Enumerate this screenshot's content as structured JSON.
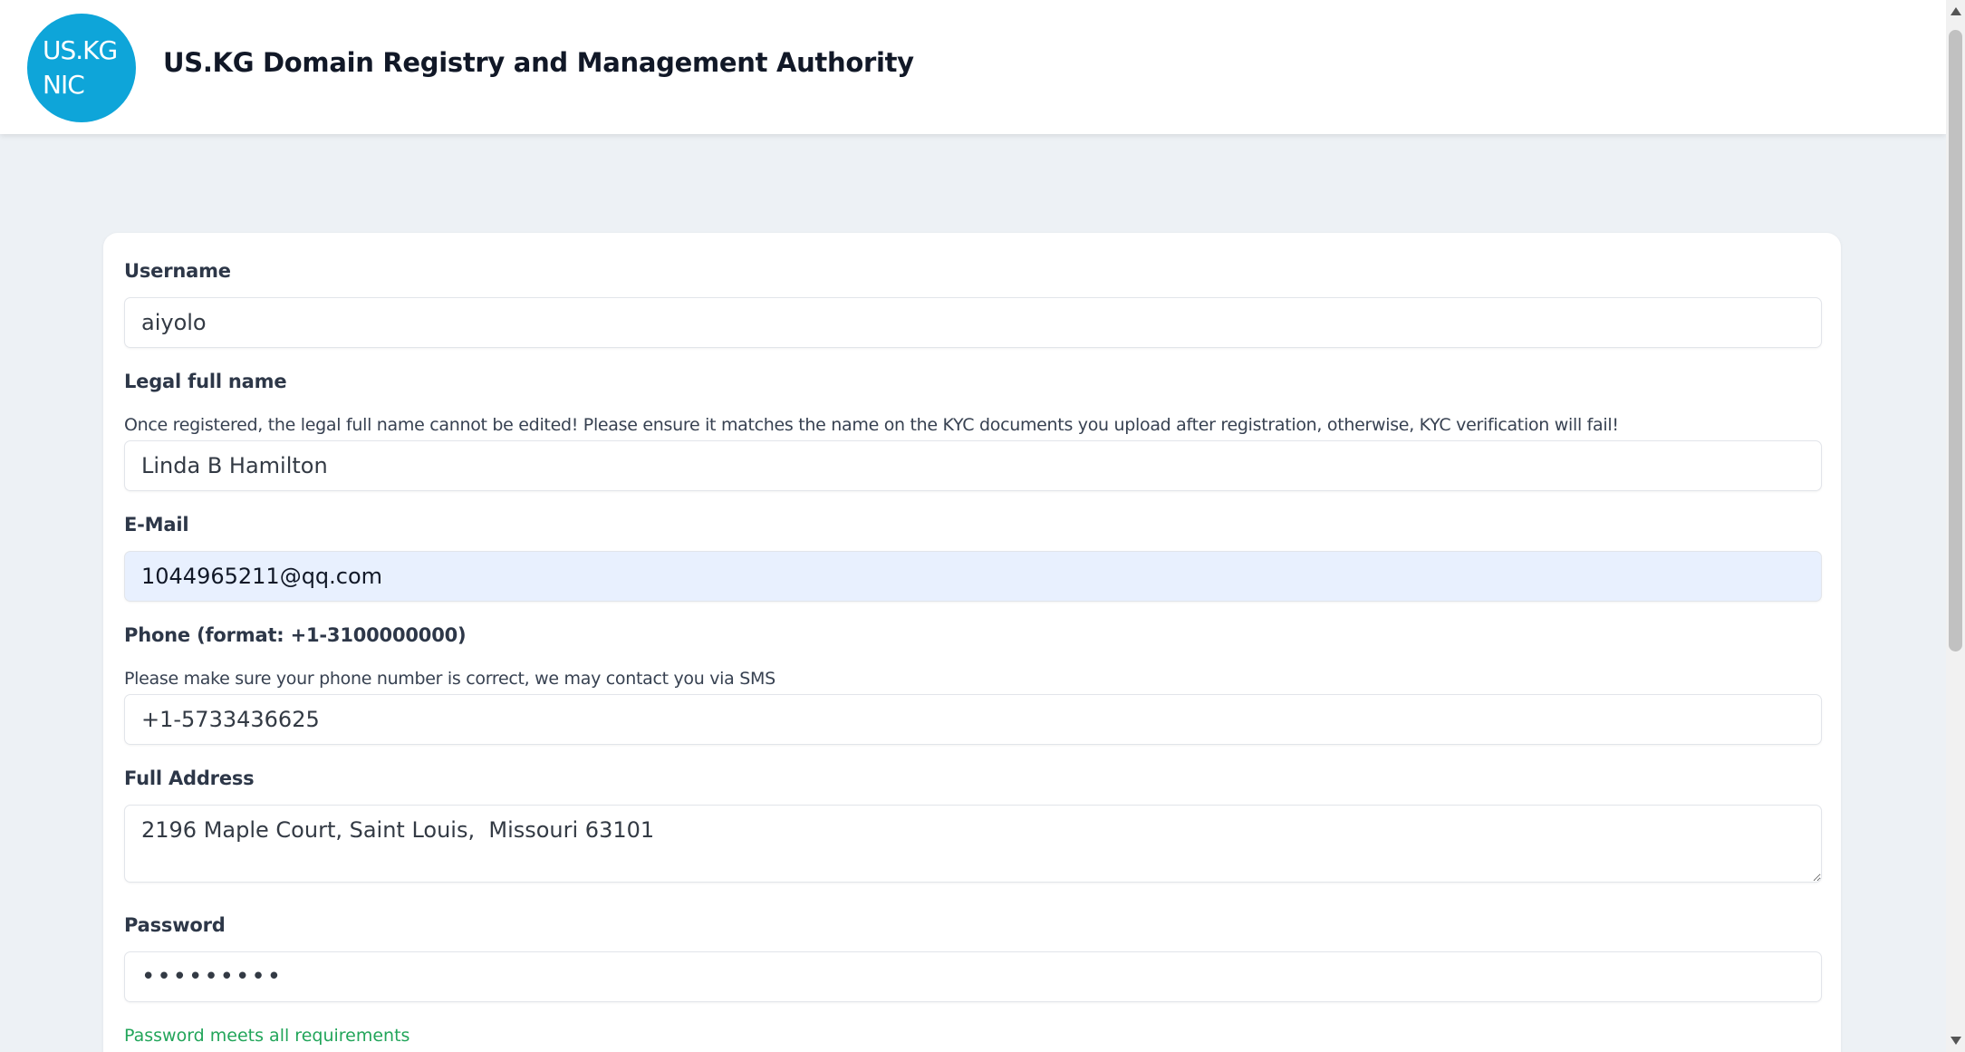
{
  "header": {
    "logo_line1": "US.KG",
    "logo_line2": "NIC",
    "title": "US.KG Domain Registry and Management Authority"
  },
  "form": {
    "username": {
      "label": "Username",
      "value": "aiyolo"
    },
    "legal_name": {
      "label": "Legal full name",
      "hint": "Once registered, the legal full name cannot be edited! Please ensure it matches the name on the KYC documents you upload after registration, otherwise, KYC verification will fail!",
      "value": "Linda B Hamilton"
    },
    "email": {
      "label": "E-Mail",
      "value": "1044965211@qq.com"
    },
    "phone": {
      "label": "Phone (format: +1-3100000000)",
      "hint": "Please make sure your phone number is correct, we may contact you via SMS",
      "value": "+1-5733436625"
    },
    "address": {
      "label": "Full Address",
      "value": "2196 Maple Court, Saint Louis,  Missouri 63101"
    },
    "password": {
      "label": "Password",
      "value": "•••••••••",
      "status": "Password meets all requirements"
    }
  },
  "colors": {
    "logo_bg": "#0ea5d9",
    "page_bg": "#edf1f5",
    "autofill_bg": "#e8f0fe",
    "success_text": "#22a55a"
  }
}
